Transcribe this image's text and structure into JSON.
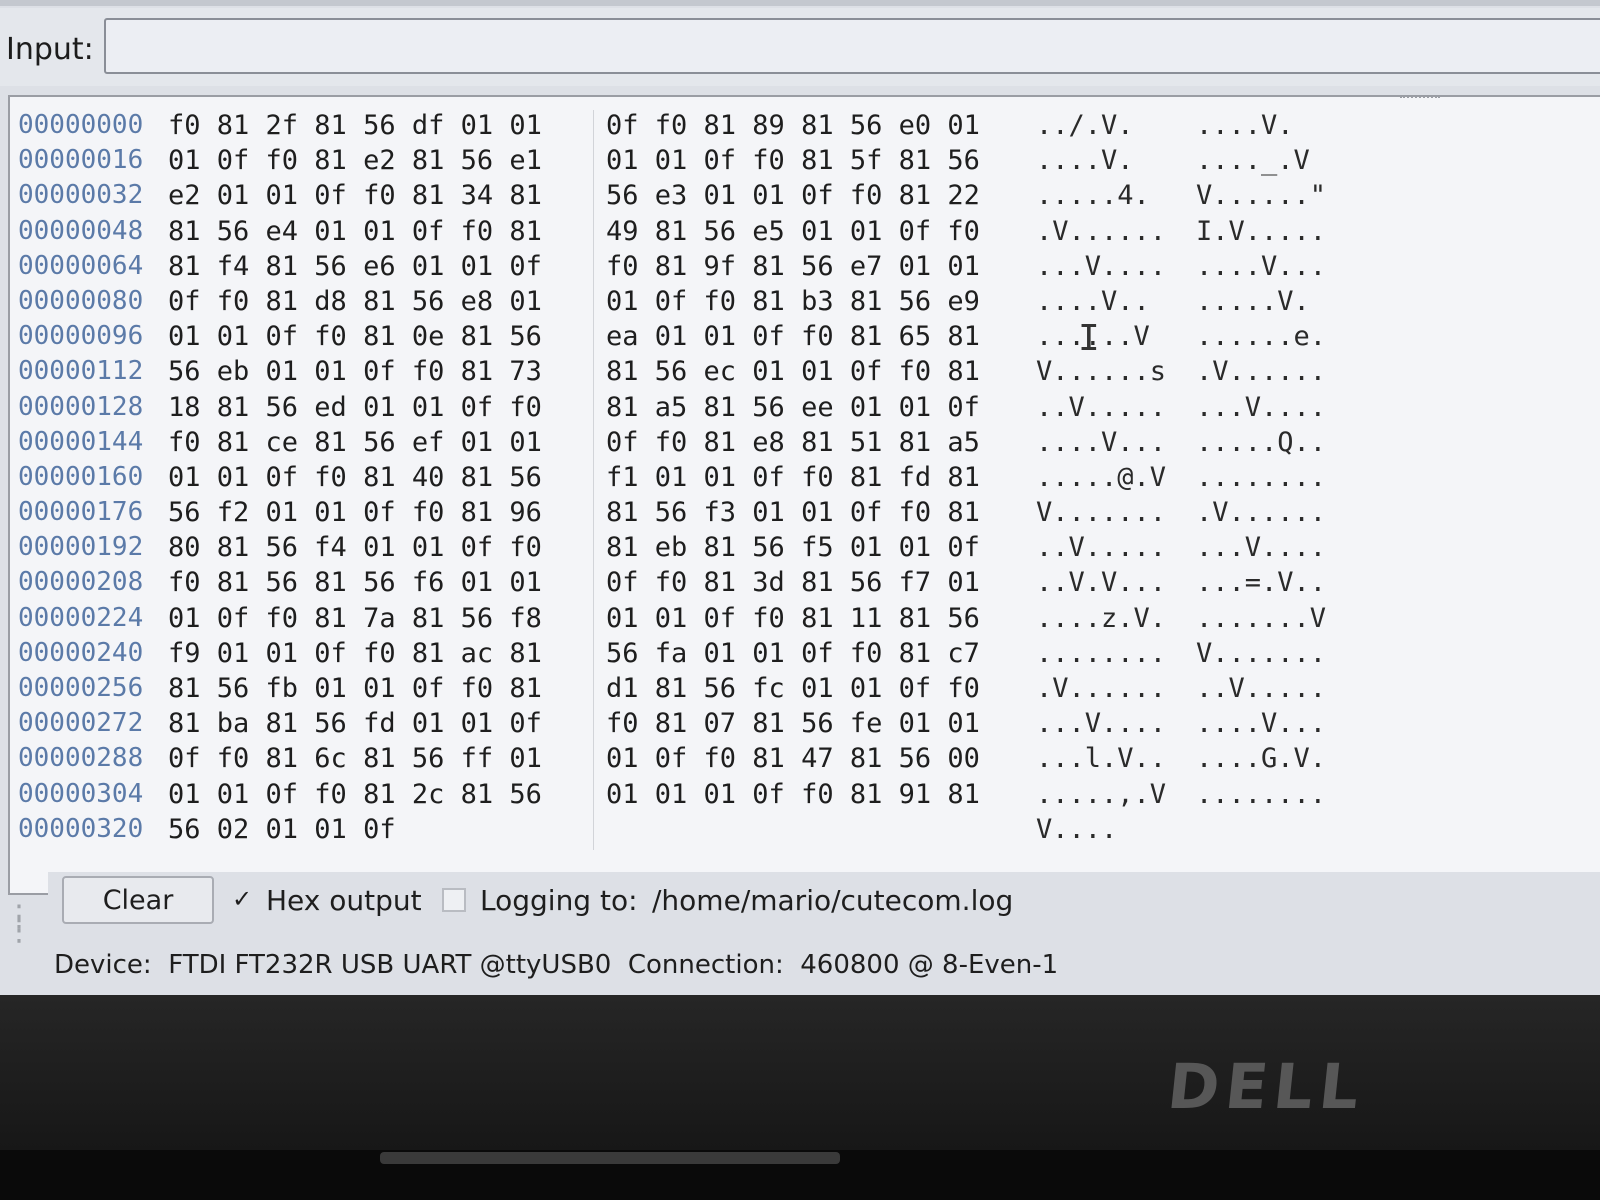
{
  "input": {
    "label": "Input:",
    "value": ""
  },
  "hex_rows": [
    {
      "offset": "00000000",
      "hex1": "f0 81 2f 81 56 df 01 01",
      "hex2": "0f f0 81 89 81 56 e0 01",
      "ascii1": "../.V.",
      "ascii2": "....V."
    },
    {
      "offset": "00000016",
      "hex1": "01 0f f0 81 e2 81 56 e1",
      "hex2": "01 01 0f f0 81 5f 81 56",
      "ascii1": "....V.",
      "ascii2": "...._.V"
    },
    {
      "offset": "00000032",
      "hex1": "e2 01 01 0f f0 81 34 81",
      "hex2": "56 e3 01 01 0f f0 81 22",
      "ascii1": ".....4.",
      "ascii2": "V......\""
    },
    {
      "offset": "00000048",
      "hex1": "81 56 e4 01 01 0f f0 81",
      "hex2": "49 81 56 e5 01 01 0f f0",
      "ascii1": ".V......",
      "ascii2": "I.V....."
    },
    {
      "offset": "00000064",
      "hex1": "81 f4 81 56 e6 01 01 0f",
      "hex2": "f0 81 9f 81 56 e7 01 01",
      "ascii1": "...V....",
      "ascii2": "....V..."
    },
    {
      "offset": "00000080",
      "hex1": "0f f0 81 d8 81 56 e8 01",
      "hex2": "01 0f f0 81 b3 81 56 e9",
      "ascii1": "....V..",
      "ascii2": ".....V."
    },
    {
      "offset": "00000096",
      "hex1": "01 01 0f f0 81 0e 81 56",
      "hex2": "ea 01 01 0f f0 81 65 81",
      "ascii1": "......V",
      "ascii2": "......e."
    },
    {
      "offset": "00000112",
      "hex1": "56 eb 01 01 0f f0 81 73",
      "hex2": "81 56 ec 01 01 0f f0 81",
      "ascii1": "V......s",
      "ascii2": ".V......"
    },
    {
      "offset": "00000128",
      "hex1": "18 81 56 ed 01 01 0f f0",
      "hex2": "81 a5 81 56 ee 01 01 0f",
      "ascii1": "..V.....",
      "ascii2": "...V...."
    },
    {
      "offset": "00000144",
      "hex1": "f0 81 ce 81 56 ef 01 01",
      "hex2": "0f f0 81 e8 81 51 81 a5",
      "ascii1": "....V...",
      "ascii2": ".....Q.."
    },
    {
      "offset": "00000160",
      "hex1": "01 01 0f f0 81 40 81 56",
      "hex2": "f1 01 01 0f f0 81 fd 81",
      "ascii1": ".....@.V",
      "ascii2": "........"
    },
    {
      "offset": "00000176",
      "hex1": "56 f2 01 01 0f f0 81 96",
      "hex2": "81 56 f3 01 01 0f f0 81",
      "ascii1": "V.......",
      "ascii2": ".V......"
    },
    {
      "offset": "00000192",
      "hex1": "80 81 56 f4 01 01 0f f0",
      "hex2": "81 eb 81 56 f5 01 01 0f",
      "ascii1": "..V.....",
      "ascii2": "...V...."
    },
    {
      "offset": "00000208",
      "hex1": "f0 81 56 81 56 f6 01 01",
      "hex2": "0f f0 81 3d 81 56 f7 01",
      "ascii1": "..V.V...",
      "ascii2": "...=.V.."
    },
    {
      "offset": "00000224",
      "hex1": "01 0f f0 81 7a 81 56 f8",
      "hex2": "01 01 0f f0 81 11 81 56",
      "ascii1": "....z.V.",
      "ascii2": ".......V"
    },
    {
      "offset": "00000240",
      "hex1": "f9 01 01 0f f0 81 ac 81",
      "hex2": "56 fa 01 01 0f f0 81 c7",
      "ascii1": "........",
      "ascii2": "V......."
    },
    {
      "offset": "00000256",
      "hex1": "81 56 fb 01 01 0f f0 81",
      "hex2": "d1 81 56 fc 01 01 0f f0",
      "ascii1": ".V......",
      "ascii2": "..V....."
    },
    {
      "offset": "00000272",
      "hex1": "81 ba 81 56 fd 01 01 0f",
      "hex2": "f0 81 07 81 56 fe 01 01",
      "ascii1": "...V....",
      "ascii2": "....V..."
    },
    {
      "offset": "00000288",
      "hex1": "0f f0 81 6c 81 56 ff 01",
      "hex2": "01 0f f0 81 47 81 56 00",
      "ascii1": "...l.V..",
      "ascii2": "....G.V."
    },
    {
      "offset": "00000304",
      "hex1": "01 01 0f f0 81 2c 81 56",
      "hex2": "01 01 01 0f f0 81 91 81",
      "ascii1": ".....,.V",
      "ascii2": "........"
    },
    {
      "offset": "00000320",
      "hex1": "56 02 01 01 0f",
      "hex2": "",
      "ascii1": "V....",
      "ascii2": ""
    }
  ],
  "controls": {
    "clear_label": "Clear",
    "hex_output_checked": true,
    "hex_output_mark": "✓",
    "hex_output_label": "Hex output",
    "logging_checked": false,
    "logging_label": "Logging to:",
    "logging_path": "/home/mario/cutecom.log"
  },
  "status": {
    "text": "Device:  FTDI FT232R USB UART @ttyUSB0  Connection:  460800 @ 8-Even-1"
  },
  "bezel": {
    "logo": "DELL"
  }
}
